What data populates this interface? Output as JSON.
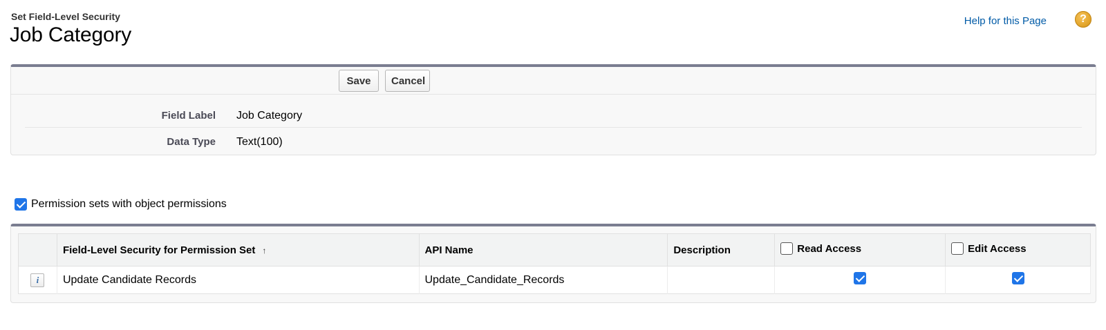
{
  "header": {
    "subtitle": "Set Field-Level Security",
    "title": "Job Category",
    "help_link": "Help for this Page",
    "help_icon_glyph": "?"
  },
  "toolbar": {
    "save_label": "Save",
    "cancel_label": "Cancel"
  },
  "details": [
    {
      "label": "Field Label",
      "value": "Job Category"
    },
    {
      "label": "Data Type",
      "value": "Text(100)"
    }
  ],
  "filter": {
    "label": "Permission sets with object permissions",
    "checked": true
  },
  "table": {
    "columns": {
      "name": "Field-Level Security for Permission Set",
      "name_sort_glyph": "↑",
      "api_name": "API Name",
      "description": "Description",
      "read_access": "Read Access",
      "edit_access": "Edit Access"
    },
    "rows": [
      {
        "info_glyph": "i",
        "name": "Update Candidate Records",
        "api_name": "Update_Candidate_Records",
        "description": "",
        "read_access": true,
        "edit_access": true
      }
    ]
  },
  "colors": {
    "accent_bar": "#7a7d90",
    "link": "#015ba7",
    "checkbox_checked": "#1f75e8",
    "help_icon": "#e2a52b"
  }
}
